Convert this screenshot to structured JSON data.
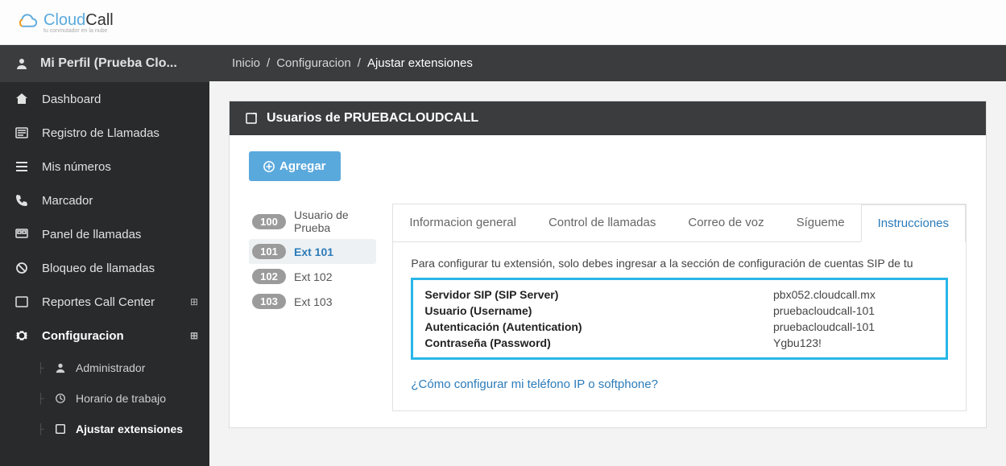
{
  "logo": {
    "brand_a": "Cloud",
    "brand_b": "Call",
    "tagline": "tu conmutador en la nube"
  },
  "profile": {
    "label": "Mi Perfil (Prueba Clo..."
  },
  "sidebar": {
    "items": [
      {
        "label": "Dashboard",
        "icon": "home-icon"
      },
      {
        "label": "Registro de Llamadas",
        "icon": "list-icon"
      },
      {
        "label": "Mis números",
        "icon": "numbers-icon"
      },
      {
        "label": "Marcador",
        "icon": "phone-icon"
      },
      {
        "label": "Panel de llamadas",
        "icon": "panel-icon"
      },
      {
        "label": "Bloqueo de llamadas",
        "icon": "block-icon"
      },
      {
        "label": "Reportes Call Center",
        "icon": "reports-icon",
        "expandable": true
      },
      {
        "label": "Configuracion",
        "icon": "gear-icon",
        "active": true,
        "expandable": true
      }
    ],
    "subitems": [
      {
        "label": "Administrador",
        "icon": "user-icon"
      },
      {
        "label": "Horario de trabajo",
        "icon": "clock-icon"
      },
      {
        "label": "Ajustar extensiones",
        "icon": "ext-icon",
        "active": true
      }
    ]
  },
  "breadcrumb": {
    "a": "Inicio",
    "b": "Configuracion",
    "c": "Ajustar extensiones"
  },
  "panel": {
    "title": "Usuarios de PRUEBACLOUDCALL"
  },
  "add_button": "Agregar",
  "extensions": [
    {
      "num": "100",
      "label": "Usuario de Prueba"
    },
    {
      "num": "101",
      "label": "Ext 101",
      "active": true
    },
    {
      "num": "102",
      "label": "Ext 102"
    },
    {
      "num": "103",
      "label": "Ext 103"
    }
  ],
  "tabs": [
    {
      "label": "Informacion general"
    },
    {
      "label": "Control de llamadas"
    },
    {
      "label": "Correo de voz"
    },
    {
      "label": "Sígueme"
    },
    {
      "label": "Instrucciones",
      "active": true
    }
  ],
  "instructions": {
    "intro": "Para configurar tu extensión, solo debes ingresar a la sección de configuración de cuentas SIP de tu",
    "rows": [
      {
        "k": "Servidor SIP (SIP Server)",
        "v": "pbx052.cloudcall.mx"
      },
      {
        "k": "Usuario (Username)",
        "v": "pruebacloudcall-101"
      },
      {
        "k": "Autenticación (Autentication)",
        "v": "pruebacloudcall-101"
      },
      {
        "k": "Contraseña (Password)",
        "v": "Ygbu123!"
      }
    ],
    "help": "¿Cómo configurar mi teléfono IP o softphone?"
  }
}
